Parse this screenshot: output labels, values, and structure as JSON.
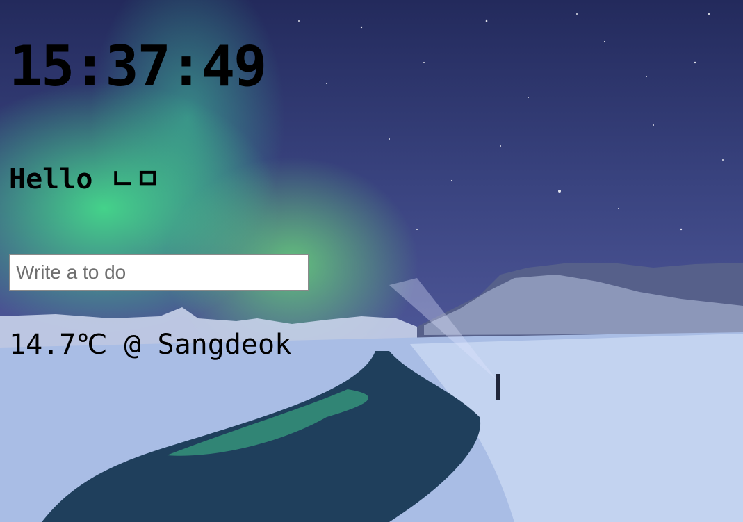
{
  "clock": {
    "time": "15:37:49"
  },
  "greeting": {
    "text": "Hello ㄴㅁ"
  },
  "todo": {
    "placeholder": "Write a to do",
    "value": ""
  },
  "weather": {
    "text": "14.7℃ @ Sangdeok"
  },
  "background": {
    "description_icon": "aurora-landscape-image"
  }
}
